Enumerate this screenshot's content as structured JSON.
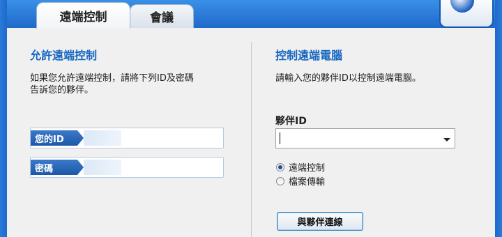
{
  "tabs": [
    {
      "label": "遠端控制",
      "active": true
    },
    {
      "label": "會議",
      "active": false
    }
  ],
  "allow": {
    "title": "允許遠端控制",
    "desc_line1": "如果您允許遠端控制，請將下列ID及密碼",
    "desc_line2": "告訴您的夥伴。",
    "id_label": "您的ID",
    "id_value": "",
    "password_label": "密碼",
    "password_value": ""
  },
  "control": {
    "title": "控制遠端電腦",
    "desc": "請輸入您的夥伴ID以控制遠端電腦。",
    "partner_label": "夥伴ID",
    "partner_value": "",
    "options": [
      {
        "label": "遠端控制",
        "checked": true
      },
      {
        "label": "檔案傳輸",
        "checked": false
      }
    ],
    "connect_label": "與夥伴連線"
  }
}
